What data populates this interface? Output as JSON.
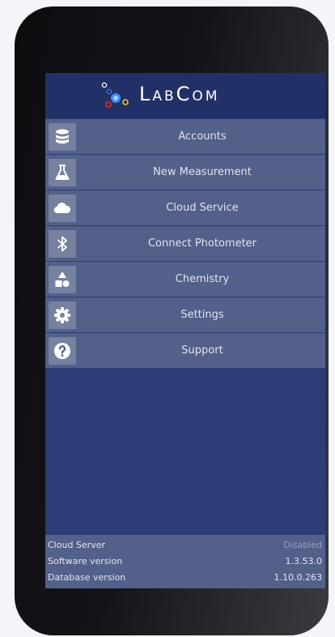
{
  "app": {
    "logo_text": "LabCom"
  },
  "menu": {
    "items": [
      {
        "label": "Accounts",
        "icon": "database-icon"
      },
      {
        "label": "New Measurement",
        "icon": "flask-icon"
      },
      {
        "label": "Cloud Service",
        "icon": "cloud-icon"
      },
      {
        "label": "Connect Photometer",
        "icon": "bluetooth-icon"
      },
      {
        "label": "Chemistry",
        "icon": "shapes-icon"
      },
      {
        "label": "Settings",
        "icon": "gear-icon"
      },
      {
        "label": "Support",
        "icon": "question-icon"
      }
    ]
  },
  "info": {
    "cloud_server_label": "Cloud Server",
    "cloud_server_value": "Disabled",
    "software_version_label": "Software version",
    "software_version_value": "1.3.53.0",
    "database_version_label": "Database version",
    "database_version_value": "1.10.0.263"
  },
  "colors": {
    "header_bg": "#213167",
    "screen_bg": "#2c3d75",
    "menu_item_bg": "#52608a",
    "icon_box_bg": "#75819f"
  }
}
